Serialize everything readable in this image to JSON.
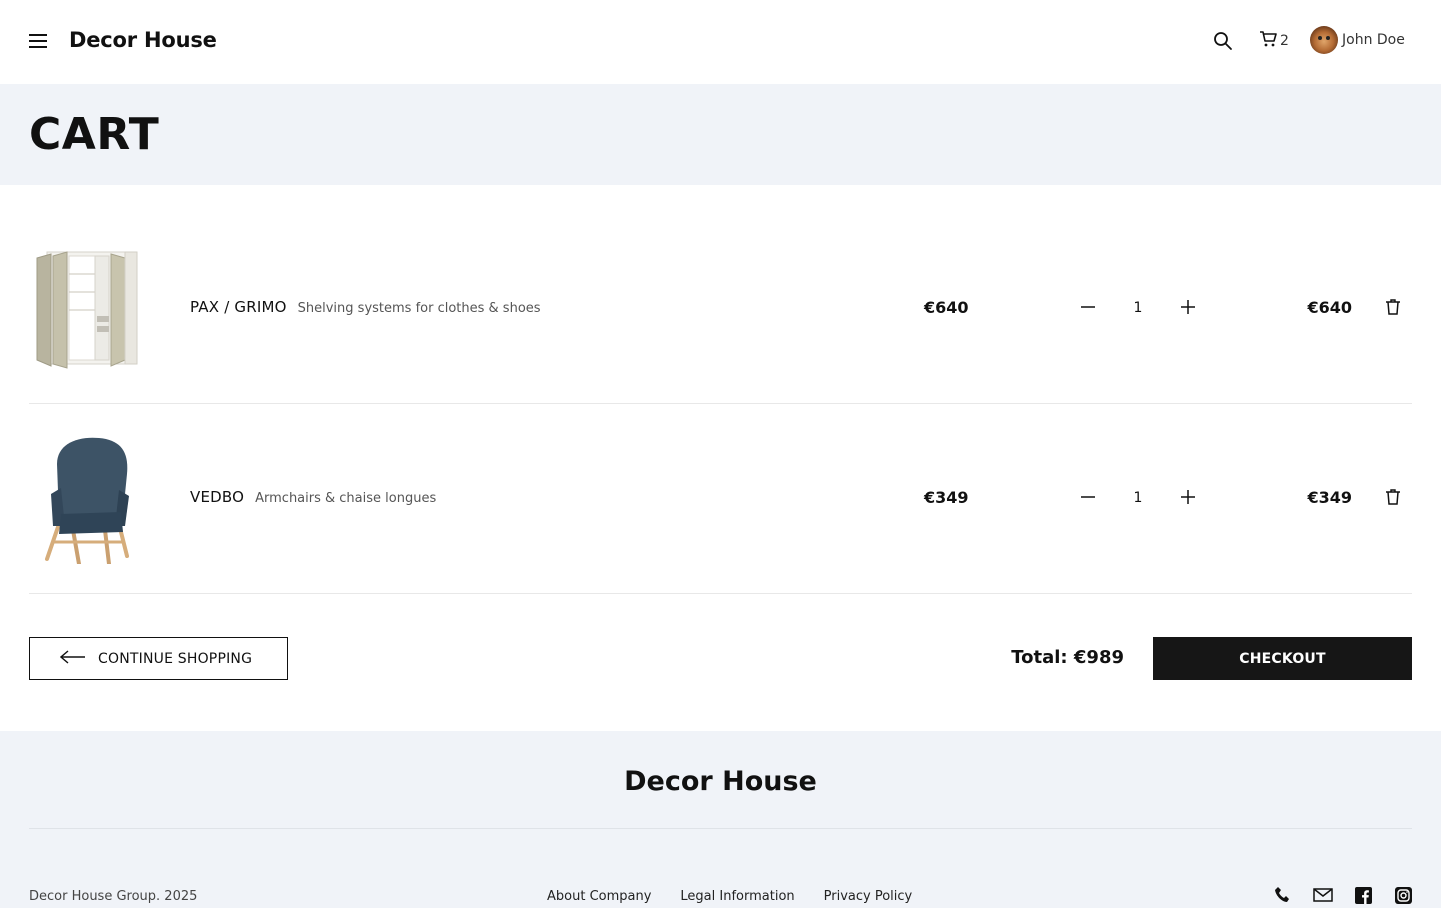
{
  "header": {
    "brand": "Decor House",
    "cart_count": "2",
    "user_name": "John Doe"
  },
  "hero": {
    "title": "CART"
  },
  "cart": {
    "items": [
      {
        "name": "PAX / GRIMO",
        "category": "Shelving systems for clothes & shoes",
        "unit_price": "€640",
        "quantity": "1",
        "line_total": "€640"
      },
      {
        "name": "VEDBO",
        "category": "Armchairs & chaise longues",
        "unit_price": "€349",
        "quantity": "1",
        "line_total": "€349"
      }
    ],
    "continue_label": "CONTINUE SHOPPING",
    "total": "Total: €989",
    "checkout_label": "CHECKOUT"
  },
  "footer": {
    "brand": "Decor House",
    "copyright": "Decor House Group. 2025",
    "links": [
      "About Company",
      "Legal Information",
      "Privacy Policy"
    ],
    "socials": [
      "phone-icon",
      "mail-icon",
      "facebook-icon",
      "instagram-icon"
    ]
  },
  "colors": {
    "accent_dark": "#161616",
    "band_bg": "#f0f3f8"
  }
}
